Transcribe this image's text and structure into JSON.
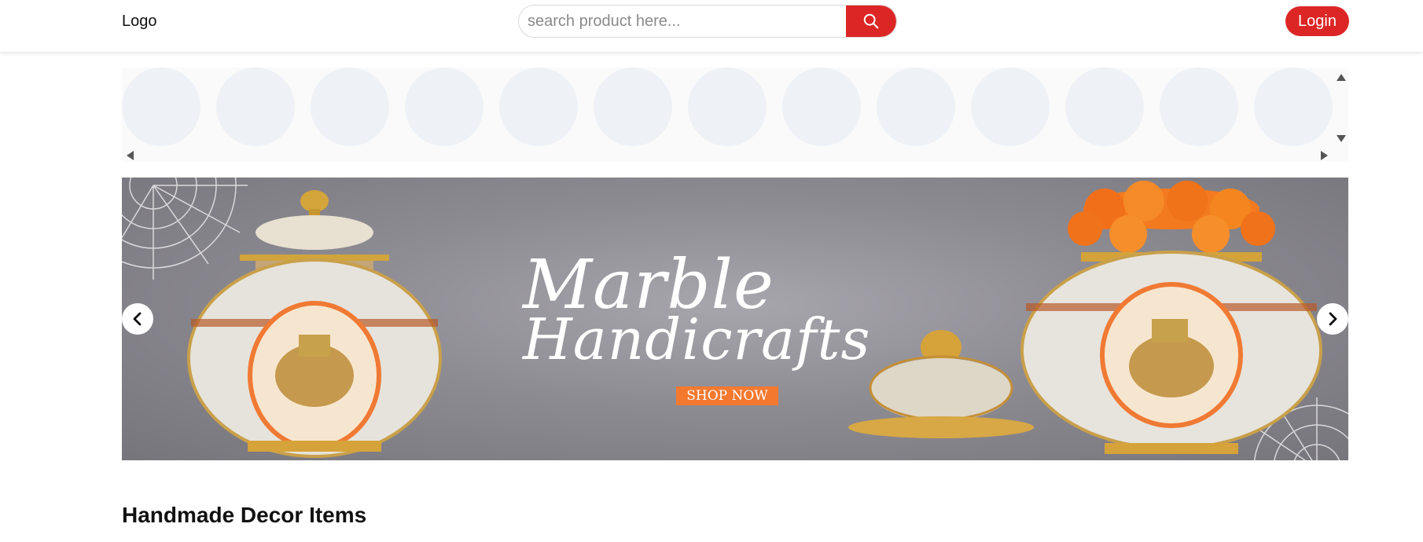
{
  "header": {
    "logo_text": "Logo",
    "search_placeholder": "search product here...",
    "search_icon": "search-icon",
    "login_label": "Login",
    "accent_color": "#dc2626"
  },
  "categories": {
    "placeholder_count_visible": 13,
    "circle_color": "#eef2f6"
  },
  "banner": {
    "title_line1": "Marble",
    "title_line2": "Handicrafts",
    "cta_label": "SHOP NOW",
    "cta_color": "#f4792f",
    "prev_icon": "chevron-left-icon",
    "next_icon": "chevron-right-icon"
  },
  "section": {
    "title": "Handmade Decor Items"
  }
}
